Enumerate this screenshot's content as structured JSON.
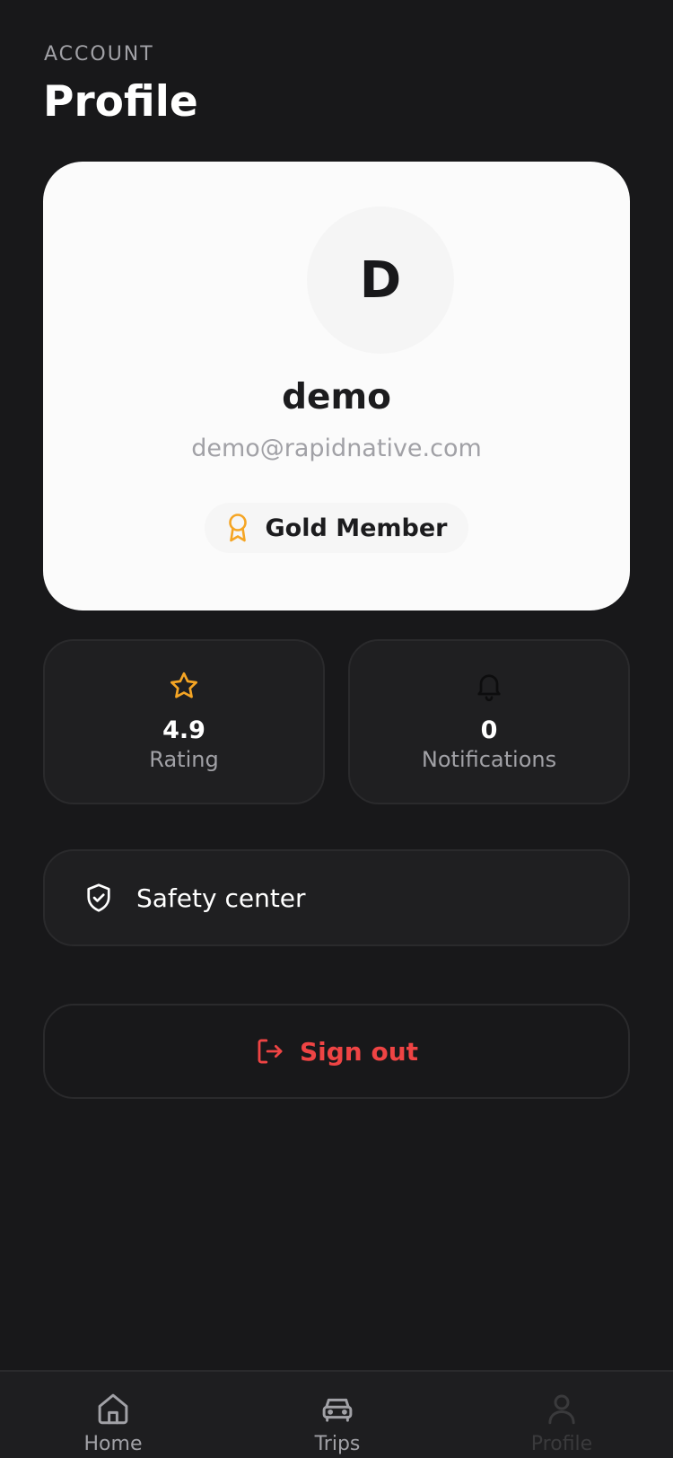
{
  "header": {
    "eyebrow": "ACCOUNT",
    "title": "Profile"
  },
  "profile": {
    "avatar_initial": "D",
    "name": "demo",
    "email": "demo@rapidnative.com",
    "membership": "Gold Member",
    "membership_icon": "award-icon"
  },
  "stats": [
    {
      "icon": "star-icon",
      "value": "4.9",
      "label": "Rating"
    },
    {
      "icon": "bell-icon",
      "value": "0",
      "label": "Notifications"
    }
  ],
  "menu": {
    "safety_label": "Safety center",
    "safety_icon": "shield-check-icon"
  },
  "signout": {
    "label": "Sign out",
    "icon": "log-out-icon"
  },
  "tabs": [
    {
      "label": "Home",
      "icon": "home-icon",
      "active": false
    },
    {
      "label": "Trips",
      "icon": "car-icon",
      "active": false
    },
    {
      "label": "Profile",
      "icon": "user-icon",
      "active": true
    }
  ],
  "colors": {
    "background": "#18181a",
    "card": "#fbfbfb",
    "accent_gold": "#f5a524",
    "danger": "#ef4444"
  }
}
